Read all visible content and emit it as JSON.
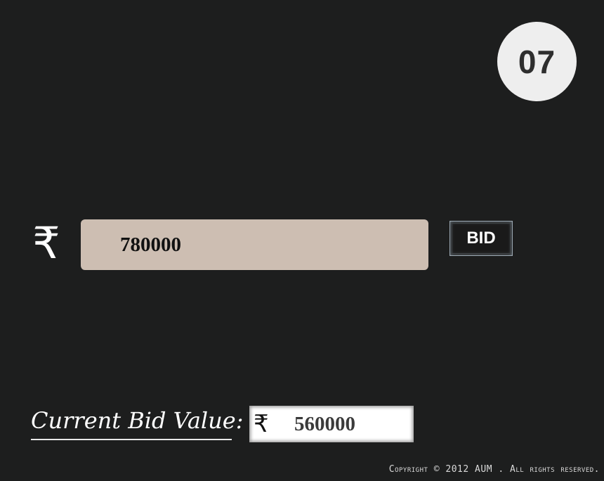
{
  "timer": {
    "value": "07"
  },
  "bid": {
    "currency_symbol": "₹",
    "input_value": "780000",
    "button_label": "BID"
  },
  "current_bid": {
    "label": "Current Bid Value:",
    "currency_symbol": "₹",
    "value": "560000"
  },
  "footer": {
    "copyright": "Copyright © 2012 AUM . All rights reserved."
  },
  "colors": {
    "background": "#1d1e1e",
    "bid_input_bg": "#cdbeb2",
    "timer_bg": "#eeeeee"
  }
}
